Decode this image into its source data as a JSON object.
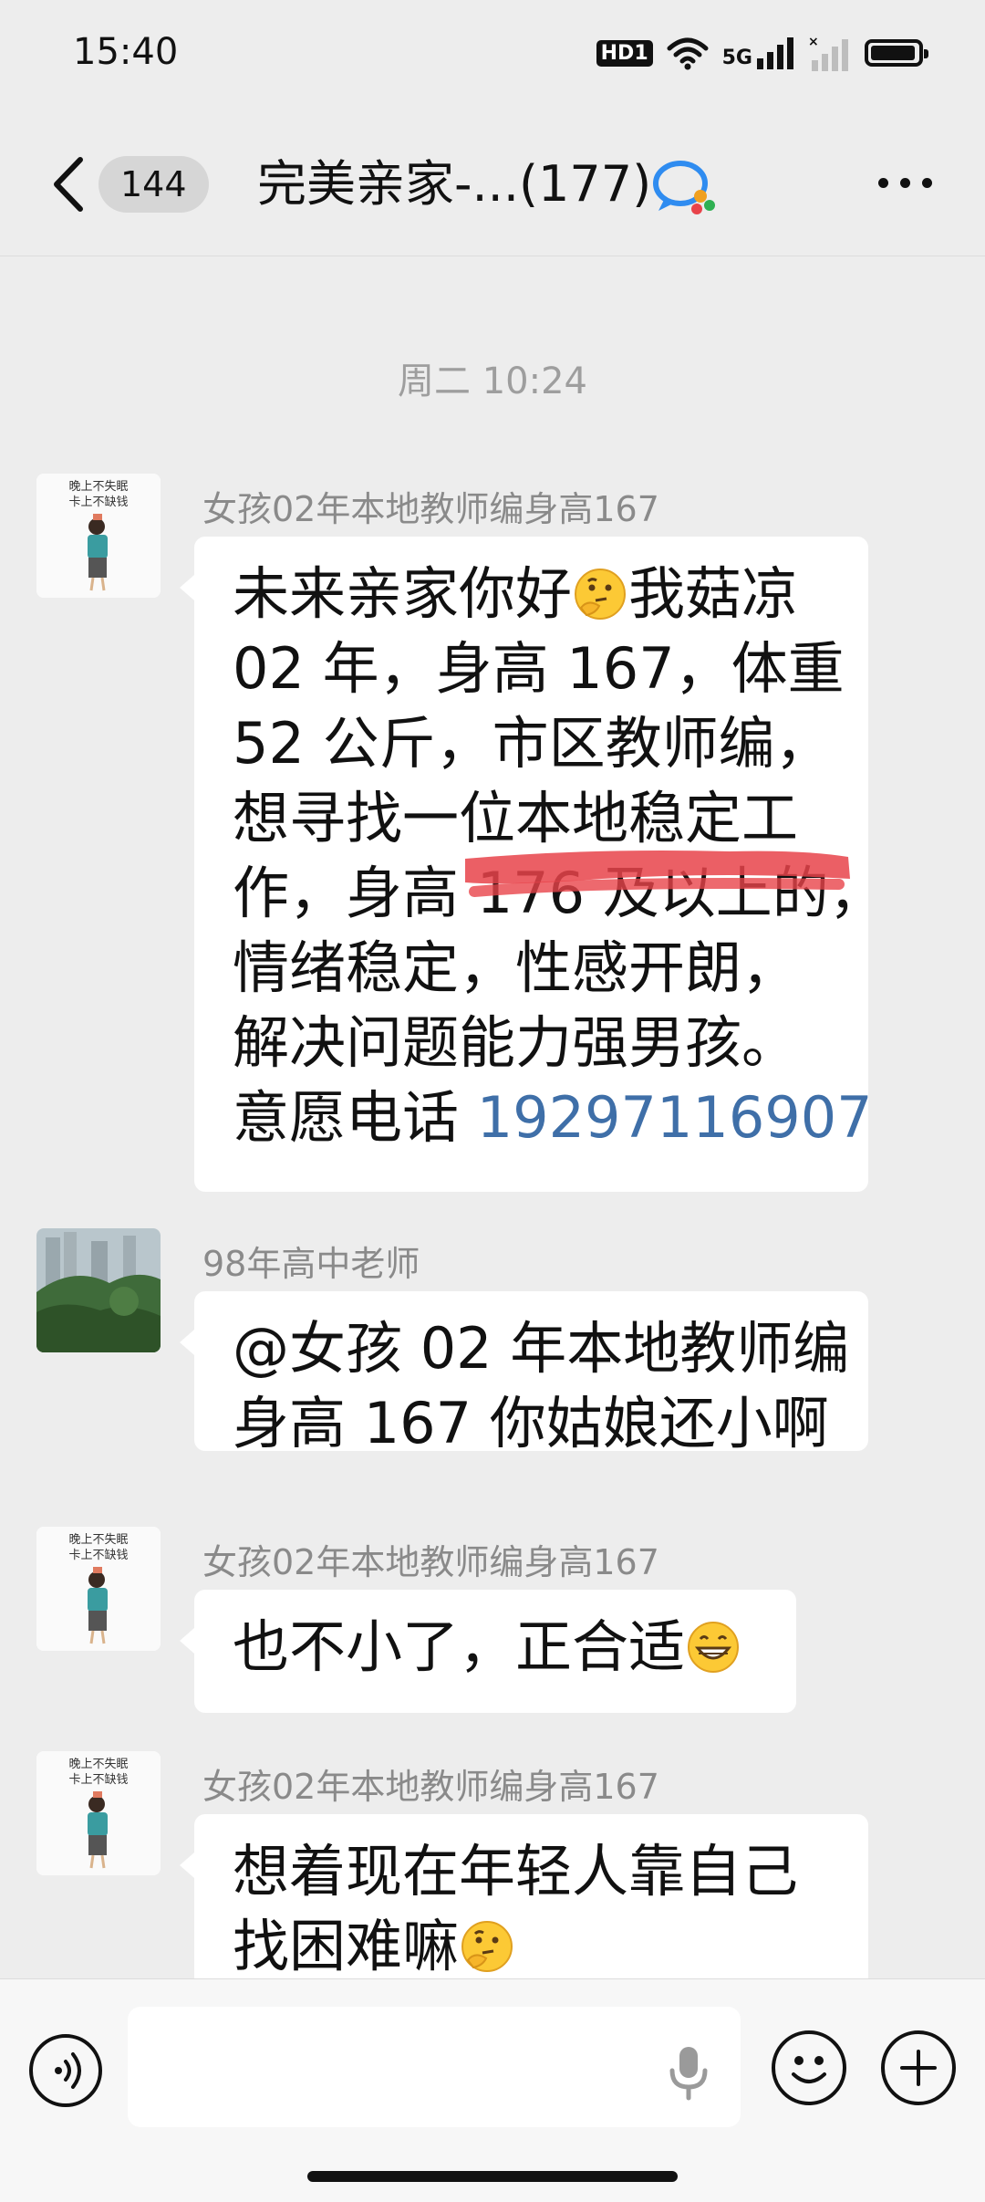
{
  "status_bar": {
    "time": "15:40",
    "hd_label": "HD1",
    "network_label": "5G",
    "battery_level": 0.95
  },
  "header": {
    "unread_count": "144",
    "title": "完美亲家-...(177)"
  },
  "chat": {
    "timestamp": "周二 10:24",
    "messages": [
      {
        "sender": "女孩02年本地教师编身高167",
        "lines": [
          "未来亲家你好",
          "我菇凉",
          "02 年，身高 167，体重",
          "52 公斤，市区教师编，",
          "想寻找一位本地稳定工",
          "作，身高 176 及以上的，",
          "情绪稳定，性感开朗，",
          "解决问题能力强男孩。",
          "意愿电话 ",
          "19297116907"
        ]
      },
      {
        "sender": "98年高中老师",
        "lines": [
          "@女孩 02 年本地教师编",
          "身高 167  你姑娘还小啊"
        ]
      },
      {
        "sender": "女孩02年本地教师编身高167",
        "lines": [
          "也不小了，正合适"
        ]
      },
      {
        "sender": "女孩02年本地教师编身高167",
        "lines": [
          "想着现在年轻人靠自己",
          "找困难嘛"
        ]
      }
    ],
    "avatar_text_line1": "晚上不失眠",
    "avatar_text_line2": "卡上不缺钱"
  },
  "colors": {
    "background": "#ededed",
    "bubble": "#ffffff",
    "phone_link": "#3f6fa8",
    "redaction": "#e8434a"
  }
}
